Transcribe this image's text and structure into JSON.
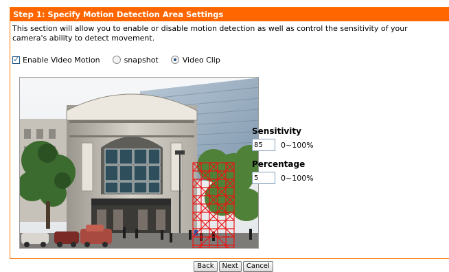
{
  "section": {
    "title": "Step 1: Specify Motion Detection Area Settings",
    "description": "This section will allow you to enable or disable motion detection as well as control the sensitivity of your camera's ability to detect movement."
  },
  "options": {
    "enable_label": "Enable Video Motion",
    "enable_checked": true,
    "snapshot_label": "snapshot",
    "videoclip_label": "Video Clip",
    "selected": "Video Clip"
  },
  "sensitivity": {
    "label": "Sensitivity",
    "value": "85",
    "range": "0~100%"
  },
  "percentage": {
    "label": "Percentage",
    "value": "5",
    "range": "0~100%"
  },
  "buttons": {
    "back": "Back",
    "next": "Next",
    "cancel": "Cancel"
  },
  "colors": {
    "header_bg": "#ff6600",
    "grid": "#ee1111"
  }
}
